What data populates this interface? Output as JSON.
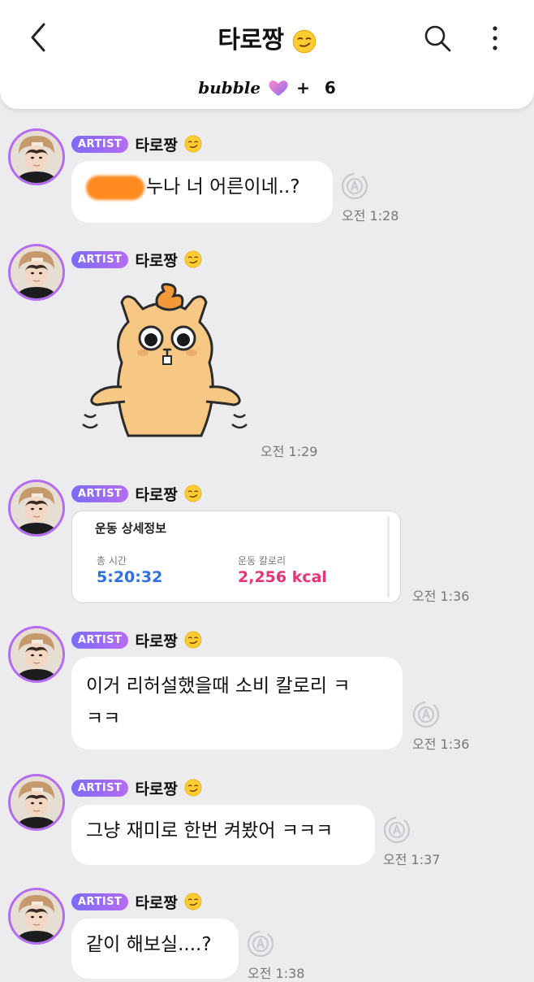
{
  "header": {
    "title": "타로짱",
    "bubble_label": "bubble",
    "plus": "+",
    "count": "6"
  },
  "badge": "ARTIST",
  "messages": [
    {
      "sender": "타로짱",
      "text": "누나 너 어른이네..?",
      "time": "오전 1:28"
    },
    {
      "sender": "타로짱",
      "sticker": "hamster-shrug-sticker",
      "time": "오전 1:29"
    },
    {
      "sender": "타로짱",
      "card": {
        "title": "운동 상세정보",
        "label1": "총 시간",
        "value1": "5:20:32",
        "label2": "운동 칼로리",
        "value2": "2,256 kcal"
      },
      "time": "오전 1:36"
    },
    {
      "sender": "타로짱",
      "line1": "이거 리허설했을때 소비 칼로리 ㅋ",
      "line2": "ㅋㅋ",
      "time": "오전 1:36"
    },
    {
      "sender": "타로짱",
      "text": "그냥 재미로 한번 켜봤어 ㅋㅋㅋ",
      "time": "오전 1:37"
    },
    {
      "sender": "타로짱",
      "text": "같이 해보실....?",
      "time": "오전 1:38"
    }
  ],
  "colors": {
    "accent": "#b46cf0",
    "blue_value": "#2f6fe0",
    "pink_value": "#e4357a",
    "redact": "#ff8a20"
  },
  "icons": {
    "back": "chevron-left-icon",
    "search": "search-icon",
    "more": "more-vertical-icon",
    "translate": "translate-icon"
  }
}
